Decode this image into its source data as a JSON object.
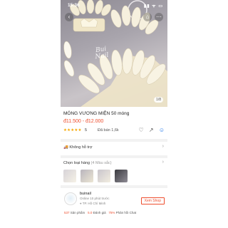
{
  "status_bar": {
    "time": "15:36",
    "icons": "▮▮ ᯤ ▭"
  },
  "nav": {
    "back_icon": "‹",
    "cart_icon": "⌂",
    "more_icon": "⋯"
  },
  "hero": {
    "watermark_line1": "Bui",
    "watermark_line2": "Nail",
    "counter": "1/8"
  },
  "product": {
    "title": "MÓNG VƯƠNG MIỆN 50 móng",
    "price": "đ11.500 - đ12.000",
    "stars": "★★★★★",
    "rating": "5",
    "sold": "Đã bán 1,6k"
  },
  "icons": {
    "heart": "♡",
    "share": "↗",
    "chat": "☺"
  },
  "shipping": {
    "label": "Không hỗ trợ"
  },
  "variants": {
    "label": "Chọn loại hàng",
    "count": "(4 Màu sắc)"
  },
  "shop": {
    "name": "buinail",
    "online": "Online 10 phút trước",
    "location": "TP. Hồ Chí Minh",
    "view_button": "Xem Shop",
    "products_count": "537",
    "products_label": "Sản phẩm",
    "rating_value": "5.0",
    "rating_label": "Đánh giá",
    "chat_rate": "75%",
    "chat_label": "Phản hồi Chat"
  },
  "colors": {
    "accent": "#ee4d2d",
    "star": "#f6a700"
  }
}
